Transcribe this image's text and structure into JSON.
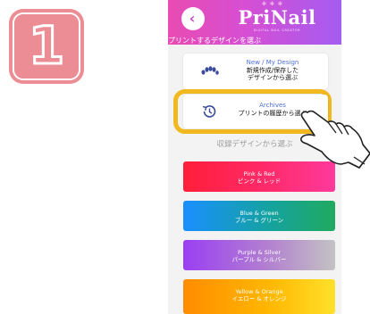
{
  "step": {
    "number": "1"
  },
  "header": {
    "back_glyph": "‹",
    "top_marks": "✻ ✻ ✻",
    "brand": "PriNail",
    "brand_sub": "DIGITAL NAIL CREATOR",
    "subtitle": "プリントするデザインを選ぶ"
  },
  "options": [
    {
      "title": "New / My Design",
      "desc_lines": [
        "新規作成/保存した",
        "デザインから選ぶ"
      ],
      "icon": "nail-dots-icon"
    },
    {
      "title": "Archives",
      "desc_lines": [
        "プリントの履歴から選ぶ"
      ],
      "icon": "history-icon"
    }
  ],
  "section_heading": "収録デザインから選ぶ",
  "color_buttons": [
    {
      "en": "Pink & Red",
      "jp": "ピンク & レッド"
    },
    {
      "en": "Blue & Green",
      "jp": "ブルー & グリーン"
    },
    {
      "en": "Purple & Silver",
      "jp": "パープル & シルバー"
    },
    {
      "en": "Yellow & Orange",
      "jp": "イエロー & オレンジ"
    }
  ],
  "colors": {
    "step_badge": "#ec8c94",
    "header_gradient": [
      "#e94bb2",
      "#a45cf0"
    ],
    "highlight": "#f1b81f",
    "option_title": "#4d6fd3"
  },
  "pointer": {
    "icon": "pointing-hand-icon"
  }
}
